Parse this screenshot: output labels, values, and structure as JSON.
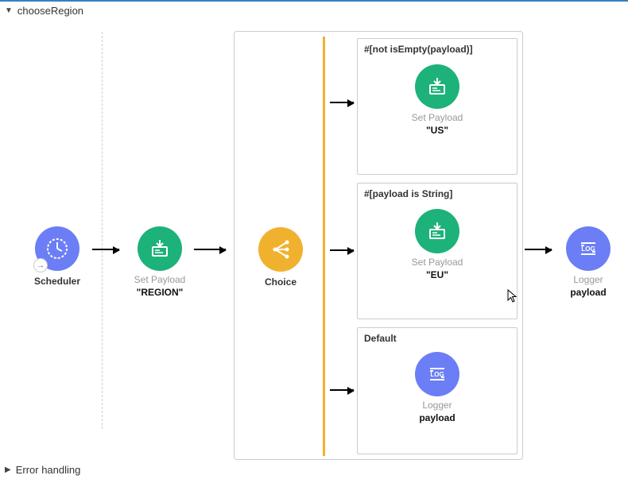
{
  "header": {
    "flow_name": "chooseRegion",
    "footer_label": "Error handling"
  },
  "scheduler": {
    "label": "Scheduler"
  },
  "set_payload_region": {
    "sublabel": "Set Payload",
    "value": "\"REGION\""
  },
  "choice": {
    "label": "Choice",
    "branches": {
      "branch1": {
        "title": "#[not isEmpty(payload)]",
        "set_payload_sublabel": "Set Payload",
        "set_payload_value": "\"US\""
      },
      "branch2": {
        "title": "#[payload is String]",
        "set_payload_sublabel": "Set Payload",
        "set_payload_value": "\"EU\""
      },
      "default": {
        "title": "Default",
        "logger_sublabel": "Logger",
        "logger_value": "payload"
      }
    }
  },
  "logger_final": {
    "sublabel": "Logger",
    "value": "payload"
  },
  "colors": {
    "scheduler": "#6b7ef5",
    "set_payload": "#1db27a",
    "choice": "#f0b22e",
    "logger": "#6b7ef5"
  }
}
